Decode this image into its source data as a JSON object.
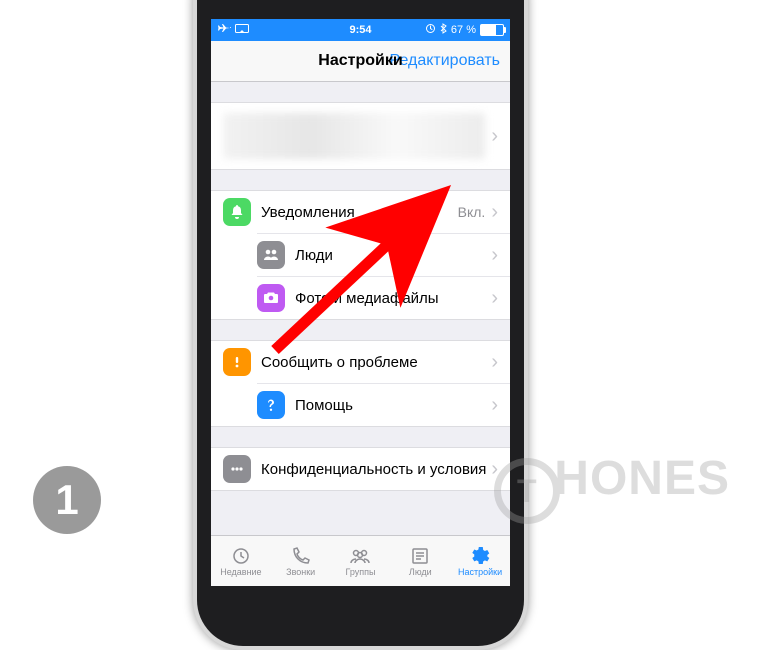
{
  "status": {
    "time": "9:54",
    "battery_pct": "67 %",
    "airplane": true
  },
  "navbar": {
    "title": "Настройки",
    "edit": "Редактировать"
  },
  "groups": [
    {
      "rows": [
        {
          "kind": "profile"
        }
      ]
    },
    {
      "rows": [
        {
          "icon": "bell-icon",
          "color": "ic-green",
          "label": "Уведомления",
          "value": "Вкл."
        },
        {
          "icon": "people-icon",
          "color": "ic-gray",
          "label": "Люди"
        },
        {
          "icon": "camera-icon",
          "color": "ic-purple",
          "label": "Фото и медиафайлы"
        }
      ]
    },
    {
      "rows": [
        {
          "icon": "alert-icon",
          "color": "ic-orange",
          "label": "Сообщить о проблеме"
        },
        {
          "icon": "help-icon",
          "color": "ic-blue",
          "label": "Помощь"
        }
      ]
    },
    {
      "rows": [
        {
          "icon": "dots-icon",
          "color": "ic-gray2",
          "label": "Конфиденциальность и условия"
        }
      ]
    }
  ],
  "tabs": [
    {
      "id": "recent",
      "label": "Недавние"
    },
    {
      "id": "calls",
      "label": "Звонки"
    },
    {
      "id": "groups",
      "label": "Группы"
    },
    {
      "id": "people",
      "label": "Люди"
    },
    {
      "id": "settings",
      "label": "Настройки",
      "active": true
    }
  ],
  "overlay": {
    "step": "1",
    "watermark": "HONES"
  }
}
